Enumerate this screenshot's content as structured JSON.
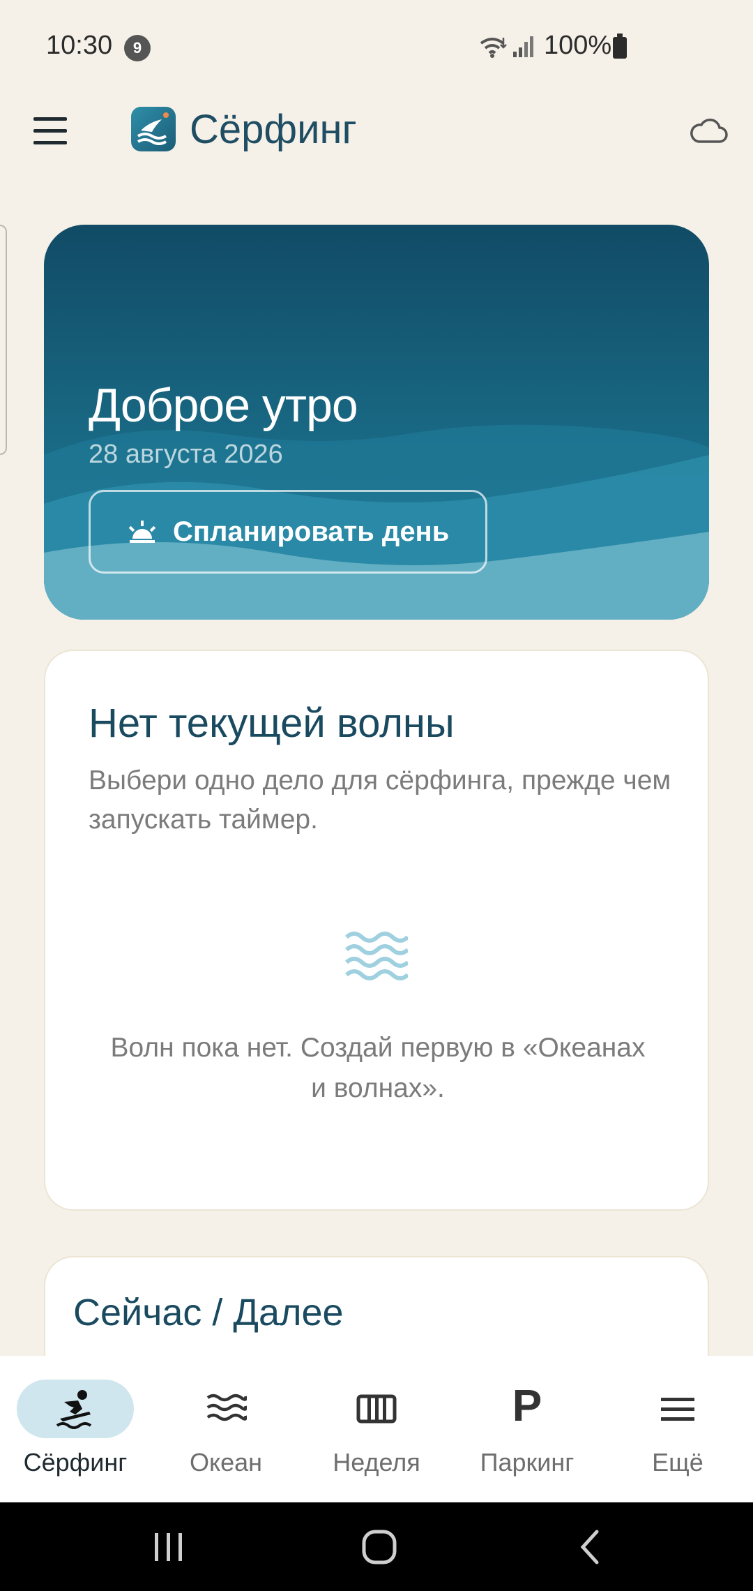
{
  "status": {
    "time": "10:30",
    "notification_count": "9",
    "battery": "100%"
  },
  "app_bar": {
    "title": "Сёрфинг"
  },
  "hero": {
    "greeting": "Доброе утро",
    "date": "28 августа 2026",
    "plan_button_label": "Спланировать день",
    "colors": {
      "top": "#114b66",
      "bottom": "#2a89a5"
    }
  },
  "current_wave": {
    "title": "Нет текущей волны",
    "subtitle": "Выбери одно дело для сёрфинга, прежде чем запускать таймер.",
    "empty_text": "Волн пока нет. Создай первую в «Океанах и волнах»."
  },
  "now_next": {
    "title": "Сейчас / Далее"
  },
  "bottom_nav": {
    "items": [
      {
        "label": "Сёрфинг",
        "icon": "surfer-icon",
        "active": true
      },
      {
        "label": "Океан",
        "icon": "waves-icon",
        "active": false
      },
      {
        "label": "Неделя",
        "icon": "week-columns-icon",
        "active": false
      },
      {
        "label": "Паркинг",
        "icon": "parking-icon",
        "glyph": "P",
        "active": false
      },
      {
        "label": "Ещё",
        "icon": "menu-icon",
        "active": false
      }
    ]
  },
  "accent_color": "#1f4d63"
}
